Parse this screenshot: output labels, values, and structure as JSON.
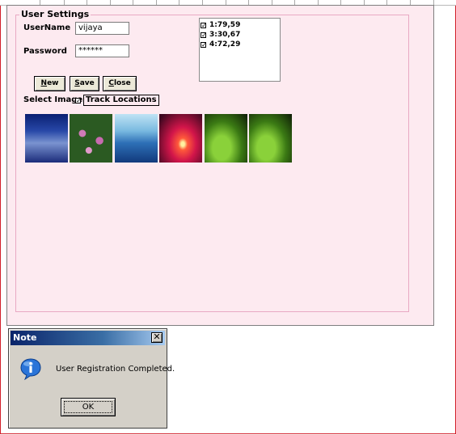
{
  "settings": {
    "group_title": "User Settings",
    "username_label": "UserName",
    "username_value": "vijaya",
    "password_label": "Password",
    "password_value": "******",
    "buttons": {
      "new": {
        "mnemonic": "N",
        "rest": "ew"
      },
      "save": {
        "mnemonic": "S",
        "rest": "ave"
      },
      "close": {
        "mnemonic": "C",
        "rest": "lose"
      }
    },
    "locations": [
      "1:79,59",
      "3:30,67",
      "4:72,29"
    ],
    "select_images_label": "Select Images",
    "track_locations_label": "Track Locations",
    "track_locations_checked": true,
    "images": [
      "frost-landscape",
      "pink-flowers",
      "blue-hills",
      "red-sunset",
      "green-leaf",
      "green-leaf"
    ]
  },
  "dialog": {
    "title": "Note",
    "close_glyph": "✕",
    "icon": "info-icon",
    "message": "User Registration Completed.",
    "ok_label": "OK"
  }
}
